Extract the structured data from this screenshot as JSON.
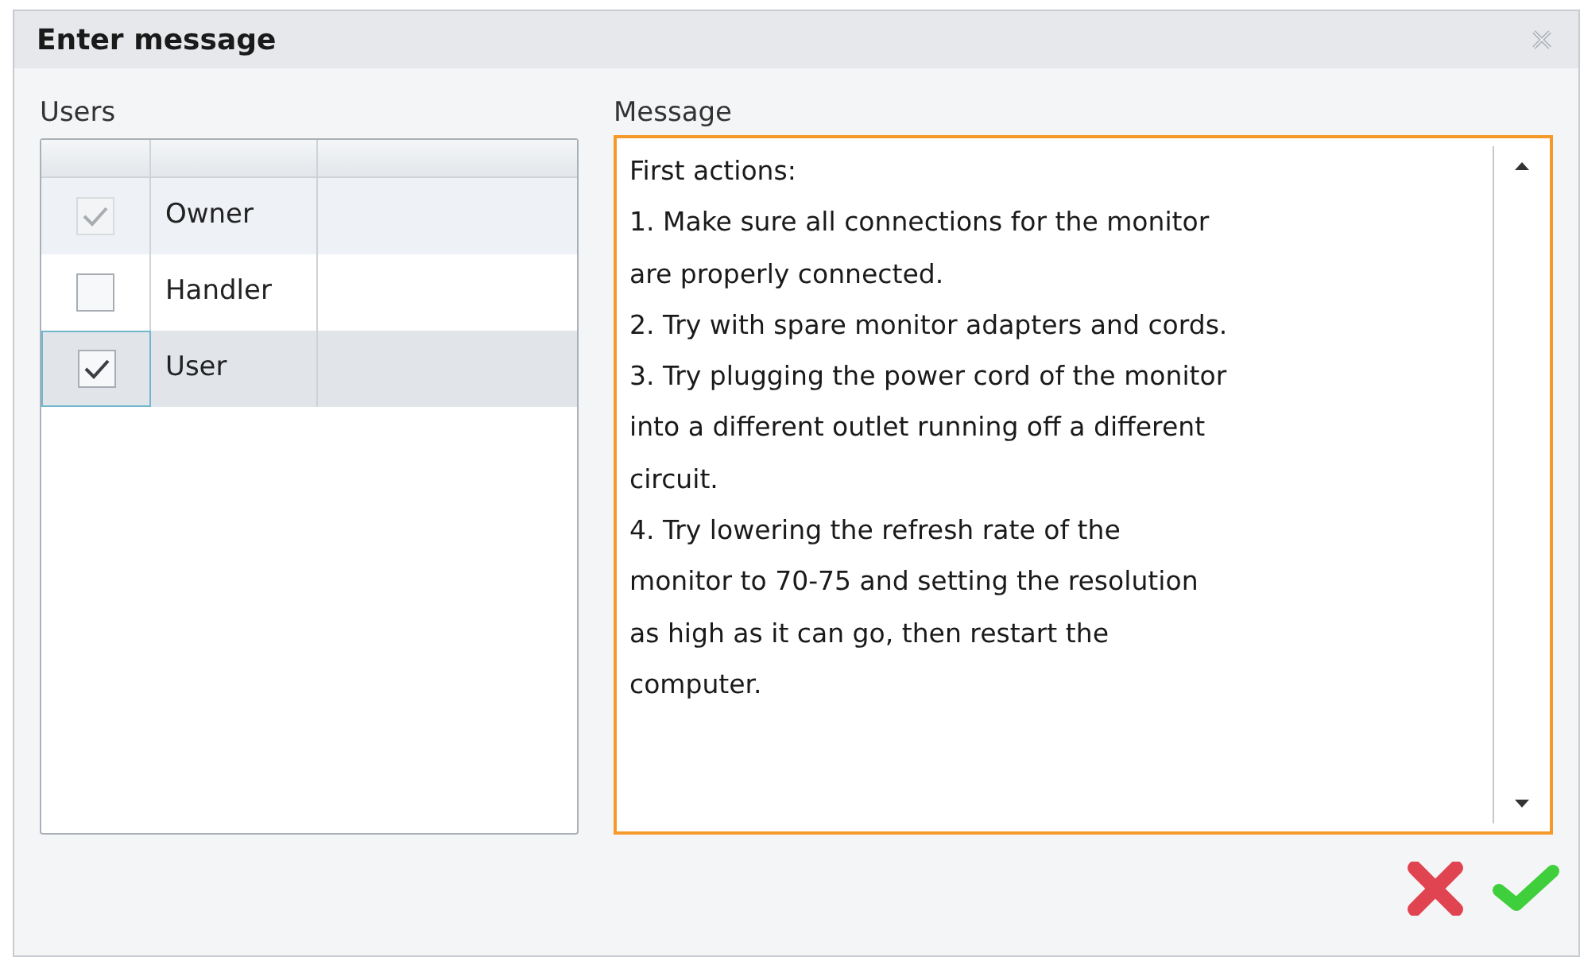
{
  "window": {
    "title": "Enter message"
  },
  "users": {
    "label": "Users",
    "rows": [
      {
        "name": "Owner",
        "checked": true,
        "disabled": true,
        "selected": false
      },
      {
        "name": "Handler",
        "checked": false,
        "disabled": false,
        "selected": false
      },
      {
        "name": "User",
        "checked": true,
        "disabled": false,
        "selected": true
      }
    ]
  },
  "message": {
    "label": "Message",
    "lines": [
      "First actions:",
      "1. Make sure all connections for the monitor",
      "are properly connected.",
      "2. Try with spare monitor adapters and cords.",
      "3. Try plugging the power cord of the monitor",
      "into a different outlet running off a different",
      "circuit.",
      "4. Try lowering the refresh rate of the",
      "monitor to 70-75 and setting the resolution",
      "as high as it can go, then restart the",
      "computer."
    ]
  }
}
